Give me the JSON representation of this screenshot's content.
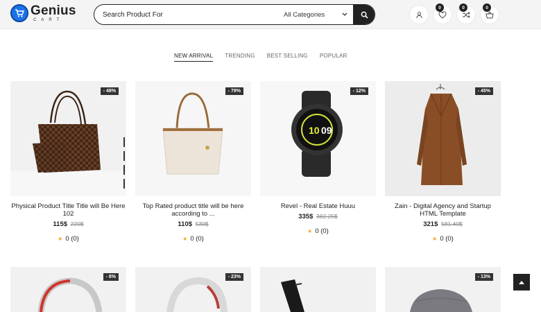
{
  "header": {
    "logo_main": "Genius",
    "logo_sub": "CART",
    "search_placeholder": "Search Product For",
    "category_selected": "All Categories",
    "wishlist_count": "0",
    "compare_count": "0",
    "cart_count": "0"
  },
  "tabs": [
    "NEW ARRIVAL",
    "TRENDING",
    "BEST SELLING",
    "POPULAR"
  ],
  "products": [
    {
      "title": "Physical Product Title Title will Be Here 102",
      "price": "115$",
      "old_price": "220$",
      "discount": "- 48%",
      "rating": "0 (0)"
    },
    {
      "title": "Top Rated product title will be here according to ...",
      "price": "110$",
      "old_price": "530$",
      "discount": "- 79%",
      "rating": "0 (0)"
    },
    {
      "title": "Revel - Real Estate Huuu",
      "price": "335$",
      "old_price": "382.25$",
      "discount": "- 12%",
      "rating": "0 (0)"
    },
    {
      "title": "Zain - Digital Agency and Startup HTML Template",
      "price": "321$",
      "old_price": "581.40$",
      "discount": "- 45%",
      "rating": "0 (0)"
    }
  ],
  "products_row2": [
    {
      "discount": "- 8%"
    },
    {
      "discount": "- 23%"
    },
    {
      "discount": ""
    },
    {
      "discount": "- 13%"
    }
  ],
  "colors": {
    "accent": "#222222",
    "logo_blue": "#1a73e8",
    "star": "#f5a623"
  }
}
